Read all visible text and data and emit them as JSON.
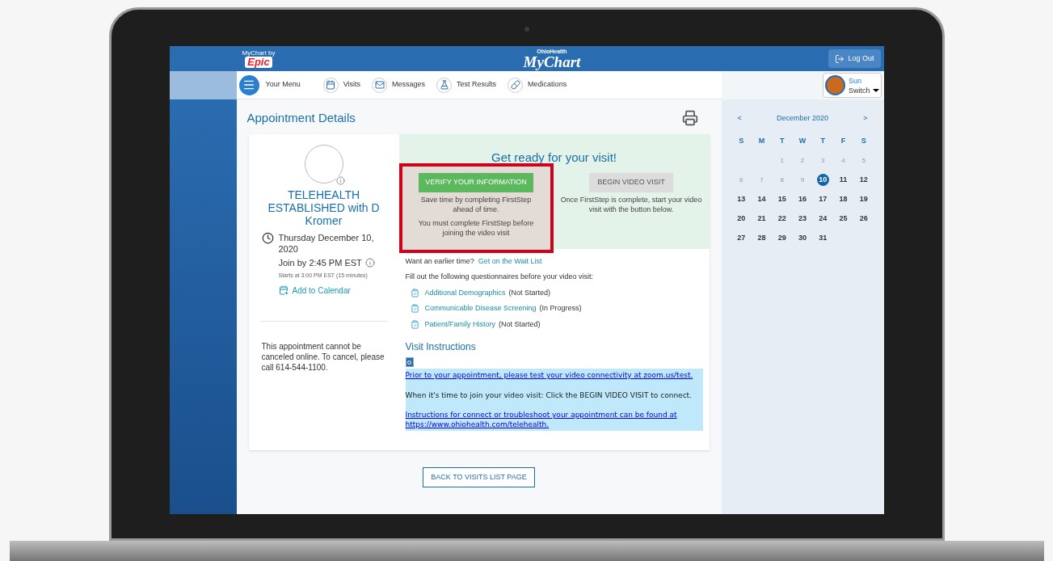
{
  "header": {
    "epic_small": "MyChart by",
    "epic_logo": "Epic",
    "brand_small": "OhioHealth",
    "brand": "MyChart",
    "logout": "Log Out"
  },
  "nav": {
    "menu": "Your Menu",
    "items": [
      {
        "label": "Visits",
        "kind": "calendar"
      },
      {
        "label": "Messages",
        "kind": "mail"
      },
      {
        "label": "Test Results",
        "kind": "flask"
      },
      {
        "label": "Medications",
        "kind": "pill"
      }
    ]
  },
  "profile": {
    "name": "Sun",
    "switch": "Switch"
  },
  "page_title": "Appointment Details",
  "appointment": {
    "title": "TELEHEALTH ESTABLISHED with D Kromer",
    "date": "Thursday December 10, 2020",
    "join": "Join by 2:45 PM EST",
    "starts": "Starts at 3:00 PM EST (15 minutes)",
    "add_calendar": "Add to Calendar",
    "cancel_note": "This appointment cannot be canceled online. To cancel, please call 614-544-1100."
  },
  "ready": {
    "heading": "Get ready for your visit!",
    "verify": {
      "button": "VERIFY YOUR INFORMATION",
      "text1": "Save time by completing FirstStep ahead of time.",
      "text2": "You must complete FirstStep before joining the video visit",
      "highlighted": true
    },
    "video": {
      "button": "BEGIN VIDEO VISIT",
      "disabled": true,
      "text": "Once FirstStep is complete, start your video visit with the button below."
    }
  },
  "waitlist": {
    "question": "Want an earlier time?",
    "link": "Get on the Wait List"
  },
  "questionnaires_intro": "Fill out the following questionnaires before your video visit:",
  "questionnaires": [
    {
      "name": "Additional Demographics",
      "status": "(Not Started)"
    },
    {
      "name": "Communicable Disease Screening",
      "status": "(In Progress)"
    },
    {
      "name": "Patient/Family History",
      "status": "(Not Started)"
    }
  ],
  "visit_instructions": {
    "heading": "Visit Instructions",
    "link1": "Prior to your appointment, please test your video connectivity at zoom.us/test.",
    "text": "When it's time to join your video visit: Click the BEGIN VIDEO VISIT to connect.",
    "link2": "Instructions for connect or troubleshoot your appointment can be found at https://www.ohiohealth.com/telehealth."
  },
  "back_button": "BACK TO VISITS LIST PAGE",
  "calendar": {
    "prev": "<",
    "month": "December 2020",
    "next": ">",
    "weekdays": [
      "S",
      "M",
      "T",
      "W",
      "T",
      "F",
      "S"
    ],
    "weeks": [
      {
        "starts_midweek": true,
        "days": [
          {
            "label": "1",
            "past": true,
            "selected": false
          },
          {
            "label": "2",
            "past": true,
            "selected": false
          },
          {
            "label": "3",
            "past": true,
            "selected": false
          },
          {
            "label": "4",
            "past": true,
            "selected": false
          },
          {
            "label": "5",
            "past": true,
            "selected": false
          }
        ]
      },
      {
        "days": [
          {
            "label": "6",
            "past": true,
            "selected": false
          },
          {
            "label": "7",
            "past": true,
            "selected": false
          },
          {
            "label": "8",
            "past": true,
            "selected": false
          },
          {
            "label": "9",
            "past": true,
            "selected": false
          },
          {
            "label": "10",
            "past": false,
            "selected": true
          },
          {
            "label": "11",
            "past": false,
            "selected": false
          },
          {
            "label": "12",
            "past": false,
            "selected": false
          }
        ]
      },
      {
        "days": [
          {
            "label": "13",
            "past": false,
            "selected": false
          },
          {
            "label": "14",
            "past": false,
            "selected": false
          },
          {
            "label": "15",
            "past": false,
            "selected": false
          },
          {
            "label": "16",
            "past": false,
            "selected": false
          },
          {
            "label": "17",
            "past": false,
            "selected": false
          },
          {
            "label": "18",
            "past": false,
            "selected": false
          },
          {
            "label": "19",
            "past": false,
            "selected": false
          }
        ]
      },
      {
        "days": [
          {
            "label": "20",
            "past": false,
            "selected": false
          },
          {
            "label": "21",
            "past": false,
            "selected": false
          },
          {
            "label": "22",
            "past": false,
            "selected": false
          },
          {
            "label": "23",
            "past": false,
            "selected": false
          },
          {
            "label": "24",
            "past": false,
            "selected": false
          },
          {
            "label": "25",
            "past": false,
            "selected": false
          },
          {
            "label": "26",
            "past": false,
            "selected": false
          }
        ]
      },
      {
        "starts_midweek": false,
        "days": [
          {
            "label": "27",
            "past": false,
            "selected": false
          },
          {
            "label": "28",
            "past": false,
            "selected": false
          },
          {
            "label": "29",
            "past": false,
            "selected": false
          },
          {
            "label": "30",
            "past": false,
            "selected": false
          },
          {
            "label": "31",
            "past": false,
            "selected": false
          }
        ]
      }
    ]
  }
}
